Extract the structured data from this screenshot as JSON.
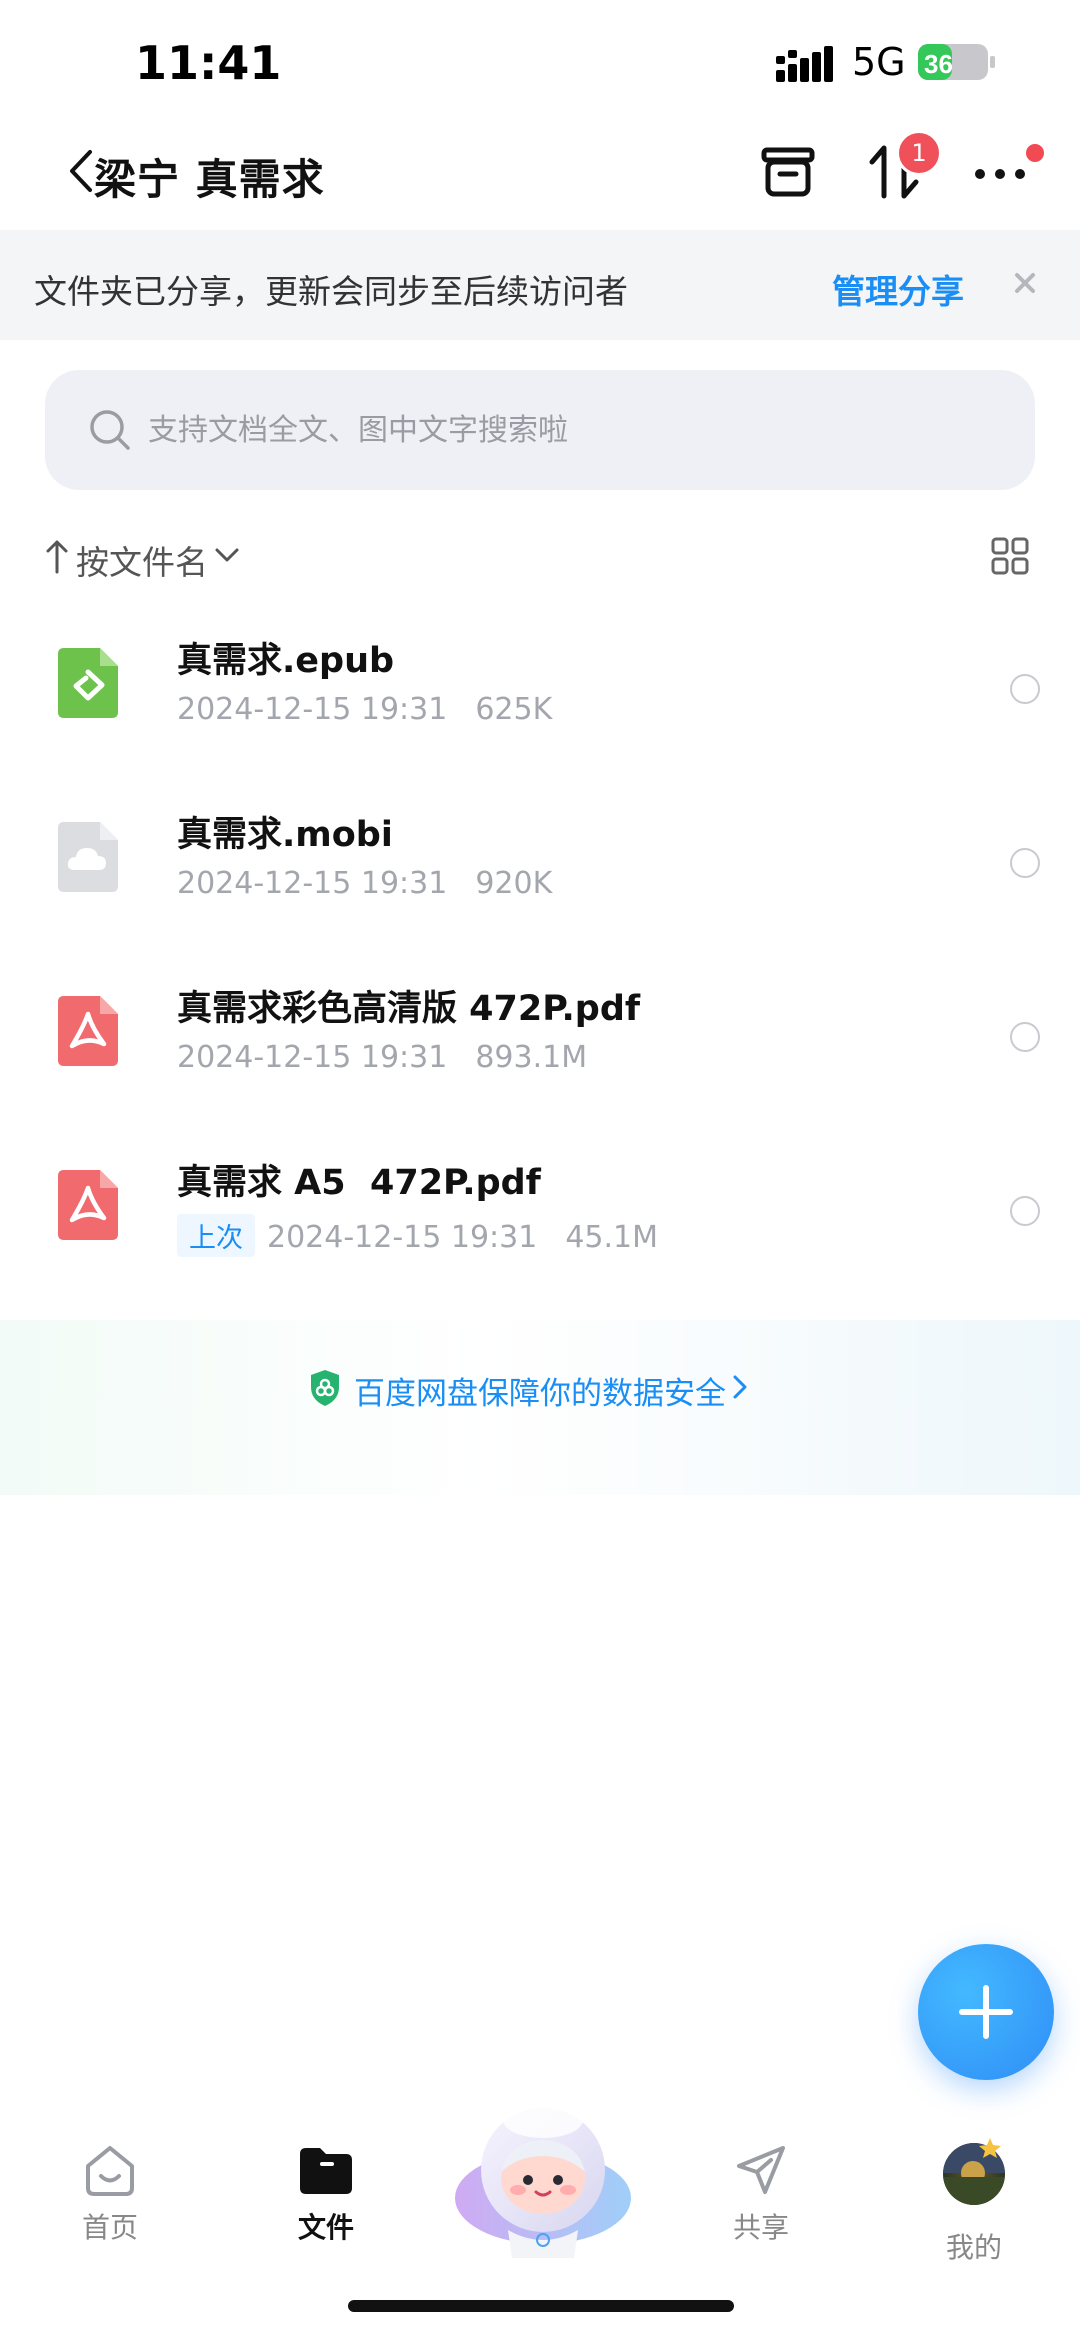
{
  "status_bar": {
    "time": "11:41",
    "network": "5G",
    "battery": "36"
  },
  "nav": {
    "title": "梁宁 真需求",
    "transfer_badge": "1"
  },
  "share_banner": {
    "text": "文件夹已分享，更新会同步至后续访问者",
    "link": "管理分享"
  },
  "search": {
    "placeholder": "支持文档全文、图中文字搜索啦"
  },
  "sort": {
    "label": "按文件名"
  },
  "files": [
    {
      "name": "真需求.epub",
      "date": "2024-12-15 19:31",
      "size": "625K",
      "type": "epub-icon"
    },
    {
      "name": "真需求.mobi",
      "date": "2024-12-15 19:31",
      "size": "920K",
      "type": "cloud-file-icon"
    },
    {
      "name": "真需求彩色高清版 472P.pdf",
      "date": "2024-12-15 19:31",
      "size": "893.1M",
      "type": "pdf-icon"
    },
    {
      "name": "真需求 A5  472P.pdf",
      "tag": "上次",
      "date": "2024-12-15 19:31",
      "size": "45.1M",
      "type": "pdf-icon"
    }
  ],
  "security": {
    "text": "百度网盘保障你的数据安全"
  },
  "tabs": [
    {
      "label": "首页",
      "icon": "home-icon"
    },
    {
      "label": "文件",
      "icon": "folder-icon",
      "active": true
    },
    {
      "label": "共享",
      "icon": "paper-plane-icon"
    },
    {
      "label": "我的",
      "icon": "avatar"
    }
  ],
  "colors": {
    "accent": "#1a8ef5",
    "badge": "#f0505a",
    "epub": "#6cc24a",
    "pdf": "#f06a6e"
  }
}
